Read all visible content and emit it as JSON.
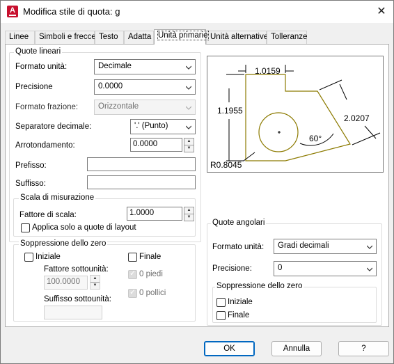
{
  "window": {
    "title": "Modifica stile di quota: g"
  },
  "tabs": [
    "Linee",
    "Simboli e frecce",
    "Testo",
    "Adatta",
    "Unità primarie",
    "Unità alternative",
    "Tolleranze"
  ],
  "linear": {
    "title": "Quote lineari",
    "unit_format_label": "Formato unità:",
    "unit_format_value": "Decimale",
    "precision_label": "Precisione",
    "precision_value": "0.0000",
    "fraction_format_label": "Formato frazione:",
    "fraction_format_value": "Orizzontale",
    "decimal_sep_label": "Separatore decimale:",
    "decimal_sep_value": "'.' (Punto)",
    "roundoff_label": "Arrotondamento:",
    "roundoff_value": "0.0000",
    "prefix_label": "Prefisso:",
    "prefix_value": "",
    "suffix_label": "Suffisso:",
    "suffix_value": ""
  },
  "scale": {
    "title": "Scala di misurazione",
    "factor_label": "Fattore di scala:",
    "factor_value": "1.0000",
    "layout_only_label": "Applica solo a quote di layout"
  },
  "zero_linear": {
    "title": "Soppressione dello zero",
    "leading_label": "Iniziale",
    "trailing_label": "Finale",
    "sub_factor_label": "Fattore sottounità:",
    "sub_factor_value": "100.0000",
    "sub_suffix_label": "Suffisso sottounità:",
    "feet_label": "0 piedi",
    "inches_label": "0 pollici"
  },
  "preview": {
    "dim_top": "1.0159",
    "dim_left": "1.1955",
    "dim_right": "2.0207",
    "dim_angle": "60°",
    "dim_radius": "R0.8045"
  },
  "angular": {
    "title": "Quote angolari",
    "unit_format_label": "Formato unità:",
    "unit_format_value": "Gradi decimali",
    "precision_label": "Precisione:",
    "precision_value": "0",
    "zero_title": "Soppressione dello zero",
    "leading_label": "Iniziale",
    "trailing_label": "Finale"
  },
  "buttons": {
    "ok": "OK",
    "cancel": "Annulla",
    "help": "?"
  }
}
